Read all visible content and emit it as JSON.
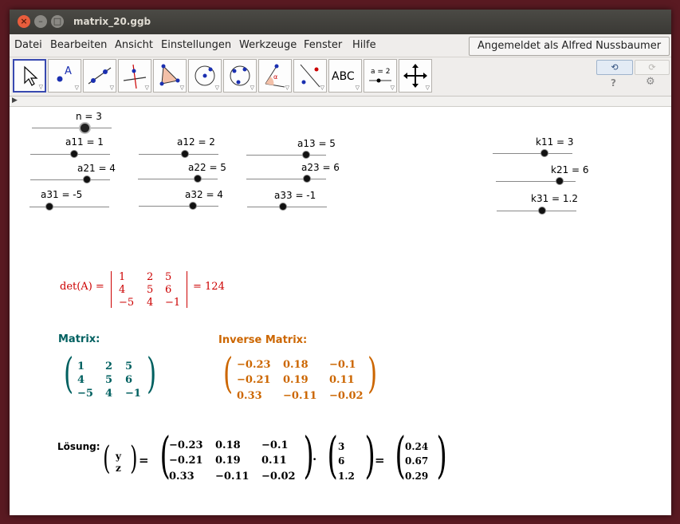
{
  "window": {
    "title": "matrix_20.ggb"
  },
  "menu": [
    "Datei",
    "Bearbeiten",
    "Ansicht",
    "Einstellungen",
    "Werkzeuge",
    "Fenster",
    "Hilfe"
  ],
  "login_label": "Angemeldet als Alfred Nussbaumer",
  "tools": [
    {
      "name": "move-tool-icon"
    },
    {
      "name": "point-tool-icon"
    },
    {
      "name": "line-tool-icon"
    },
    {
      "name": "perpendicular-tool-icon"
    },
    {
      "name": "polygon-tool-icon"
    },
    {
      "name": "circle-tool-icon"
    },
    {
      "name": "circle-three-points-tool-icon"
    },
    {
      "name": "angle-tool-icon"
    },
    {
      "name": "reflect-tool-icon"
    },
    {
      "name": "text-tool-icon"
    },
    {
      "name": "slider-tool-icon"
    },
    {
      "name": "move-graphics-tool-icon"
    }
  ],
  "text_tool_label": "ABC",
  "slider_tool_label": "a = 2",
  "sliders": {
    "n": "n = 3",
    "a11": "a11 = 1",
    "a12": "a12 = 2",
    "a13": "a13 = 5",
    "a21": "a21 = 4",
    "a22": "a22 = 5",
    "a23": "a23 = 6",
    "a31": "a31 = -5",
    "a32": "a32 = 4",
    "a33": "a33 = -1",
    "k11": "k11 = 3",
    "k21": "k21 = 6",
    "k31": "k31 = 1.2"
  },
  "det": {
    "label": "det(A) =",
    "result": "= 124",
    "rows": [
      [
        "1",
        "2",
        "5"
      ],
      [
        "4",
        "5",
        "6"
      ],
      [
        "−5",
        "4",
        "−1"
      ]
    ]
  },
  "matrix": {
    "title": "Matrix:",
    "rows": [
      [
        "1",
        "2",
        "5"
      ],
      [
        "4",
        "5",
        "6"
      ],
      [
        "−5",
        "4",
        "−1"
      ]
    ]
  },
  "inverse": {
    "title": "Inverse Matrix:",
    "rows": [
      [
        "−0.23",
        "0.18",
        "−0.1"
      ],
      [
        "−0.21",
        "0.19",
        "0.11"
      ],
      [
        "0.33",
        "−0.11",
        "−0.02"
      ]
    ]
  },
  "solution": {
    "label": "Lösung:",
    "vars": [
      "y",
      "z"
    ],
    "eq": "=",
    "dot": "·",
    "eq2": "=",
    "inverse_rows": [
      [
        "−0.23",
        "0.18",
        "−0.1"
      ],
      [
        "−0.21",
        "0.19",
        "0.11"
      ],
      [
        "0.33",
        "−0.11",
        "−0.02"
      ]
    ],
    "vector": [
      "3",
      "6",
      "1.2"
    ],
    "result": [
      "0.24",
      "0.67",
      "0.29"
    ]
  },
  "colors": {
    "det": "#cc0000",
    "matrix": "#006060",
    "inverse": "#cc6600",
    "accent": "#3849b0"
  }
}
